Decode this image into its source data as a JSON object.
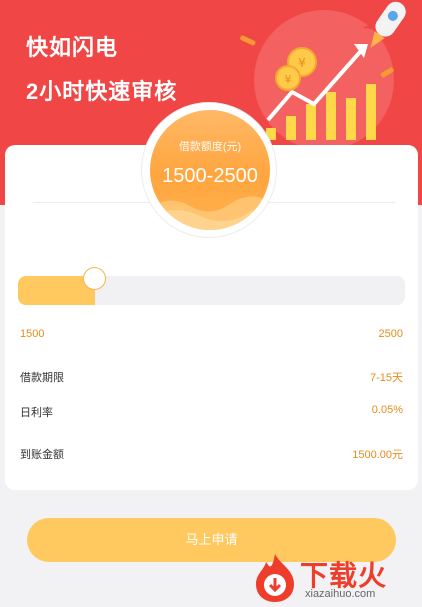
{
  "hero": {
    "title_line1": "快如闪电",
    "title_line2": "2小时快速审核",
    "background_color": "#f04646"
  },
  "loan_circle": {
    "label": "借款额度(元)",
    "value": "1500-2500"
  },
  "slider": {
    "value_fraction": 0.2,
    "min_label": "1500",
    "max_label": "2500"
  },
  "info": [
    {
      "label": "借款期限",
      "value": "7-15天"
    },
    {
      "label": "日利率",
      "value": "0.05%"
    },
    {
      "label": "到账金额",
      "value": "1500.00元"
    }
  ],
  "apply_button": {
    "label": "马上申请"
  },
  "watermark": {
    "name": "下载火",
    "url": "xiazaihuo.com",
    "icon": "flame-download-icon"
  },
  "colors": {
    "accent": "#ffc95f",
    "accent_text": "#e88b1c",
    "circle": "#ffa53e"
  }
}
